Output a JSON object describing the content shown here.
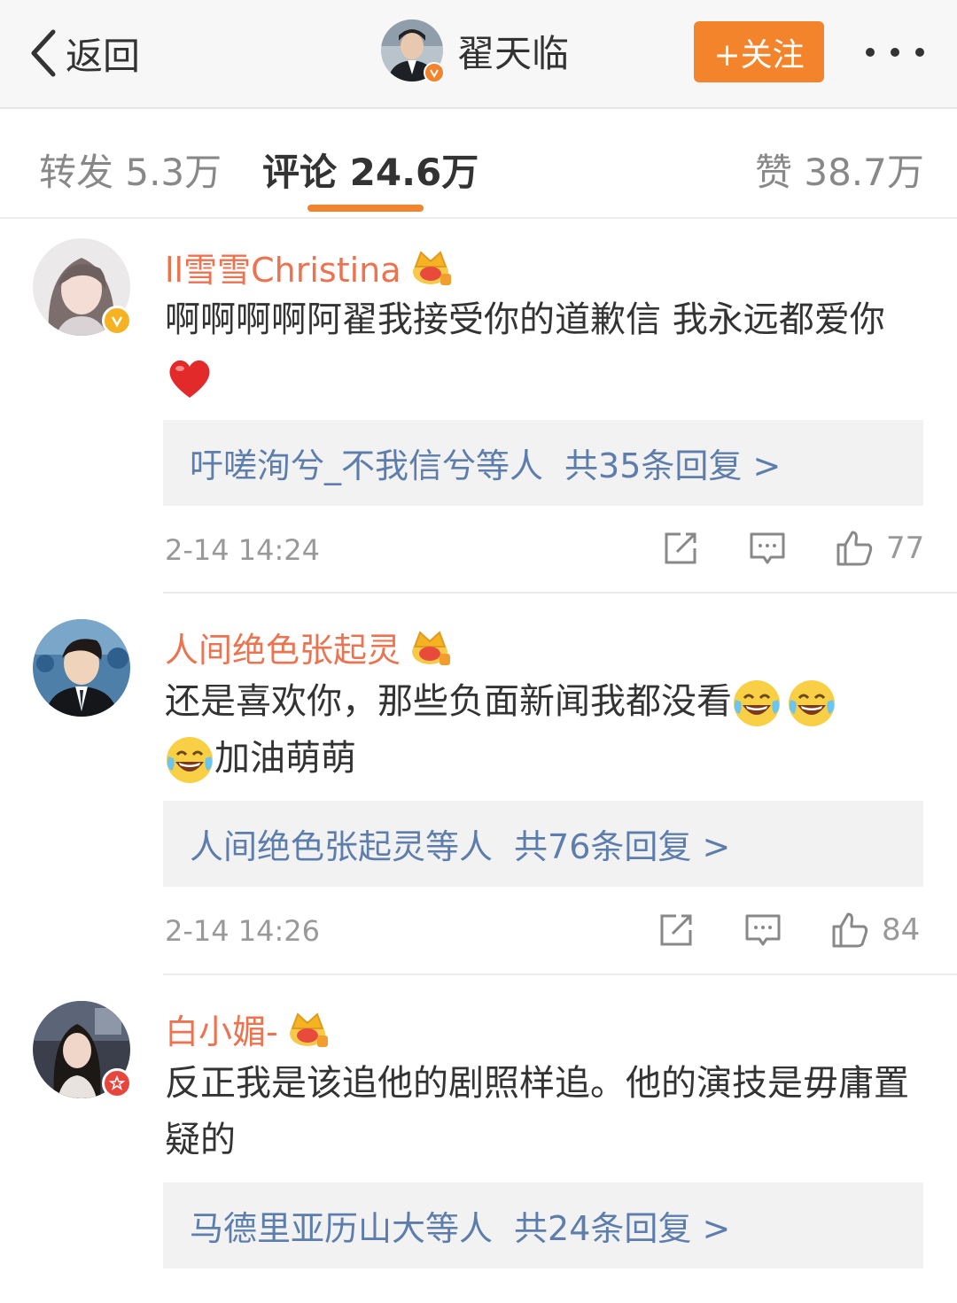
{
  "nav": {
    "back_label": "返回",
    "user_name": "翟天临",
    "follow_label": "+关注"
  },
  "tabs": {
    "repost": "转发 5.3万",
    "comments": "评论 24.6万",
    "likes": "赞 38.7万"
  },
  "colors": {
    "accent": "#f4842c",
    "username": "#eb7350",
    "link": "#5d7eac",
    "verified_badge": "#f5b323",
    "member_badge": "#e8453c"
  },
  "comments": [
    {
      "user": "ll雪雪Christina",
      "text": "啊啊啊啊阿翟我接受你的道歉信  我永远都爱你",
      "replies": "吁嗟洵兮_不我信兮等人",
      "reply_count": "共35条回复 >",
      "time": "2-14 14:24",
      "likes": "77",
      "badge": "verified-icon"
    },
    {
      "user": "人间绝色张起灵",
      "text_part1": "还是喜欢你，那些负面新闻我都没看",
      "text_part2": "加油萌萌",
      "emoji": "laughing-tears-emoji",
      "replies": "人间绝色张起灵等人",
      "reply_count": "共76条回复 >",
      "time": "2-14 14:26",
      "likes": "84"
    },
    {
      "user": "白小媚-",
      "text": "反正我是该追他的剧照样追。他的演技是毋庸置疑的",
      "replies": "马德里亚历山大等人",
      "reply_count": "共24条回复 >",
      "badge": "member-star-icon"
    }
  ]
}
